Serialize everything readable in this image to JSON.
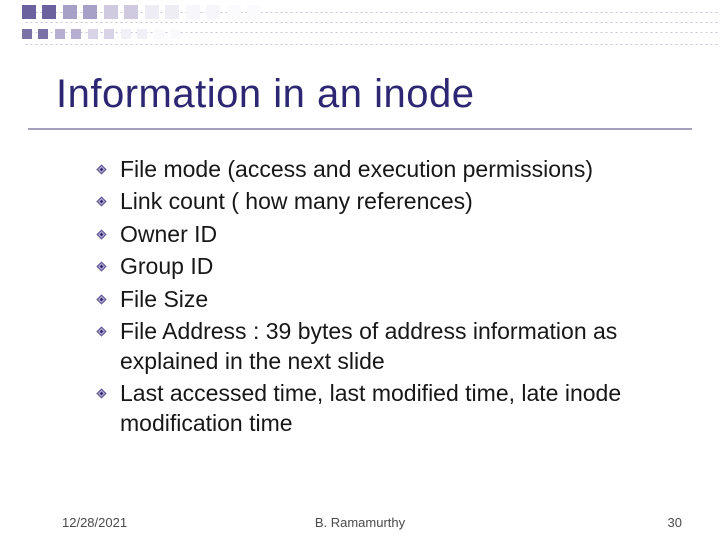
{
  "title": "Information in an inode",
  "bullets": [
    "File mode (access and execution permissions)",
    "Link count ( how many references)",
    "Owner ID",
    "Group ID",
    "File Size",
    "File Address : 39 bytes of address information as explained in the next slide",
    "Last accessed time, last modified time, late inode modification time"
  ],
  "footer": {
    "date": "12/28/2021",
    "author": "B. Ramamurthy",
    "slide_number": "30"
  },
  "theme": {
    "title_color": "#2c2673",
    "bullet_colors": {
      "outer": "#605796",
      "mid": "#8d85b8",
      "inner": "#2c2673"
    },
    "ornament": {
      "big": [
        "#6b619e",
        "#a8a1c7",
        "#efedf4"
      ],
      "small": [
        "#7b72a8",
        "#b6afd0",
        "#f2f0f7"
      ]
    }
  }
}
